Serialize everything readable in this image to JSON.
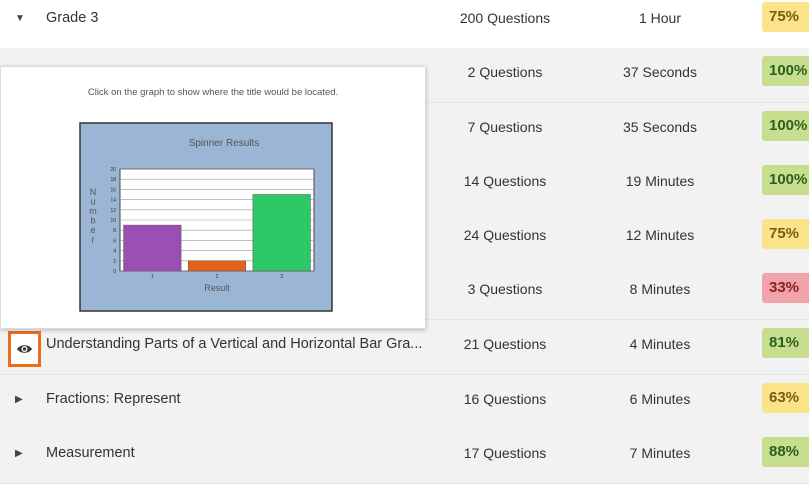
{
  "rows": [
    {
      "title": "Grade 3",
      "questions": "200 Questions",
      "time": "1 Hour",
      "score": "75%",
      "score_color": "yellow",
      "caret": "down"
    },
    {
      "title": "",
      "questions": "2 Questions",
      "time": "37 Seconds",
      "score": "100%",
      "score_color": "green"
    },
    {
      "title": "",
      "questions": "7 Questions",
      "time": "35 Seconds",
      "score": "100%",
      "score_color": "green"
    },
    {
      "title": "",
      "questions": "14 Questions",
      "time": "19 Minutes",
      "score": "100%",
      "score_color": "green"
    },
    {
      "title": "",
      "questions": "24 Questions",
      "time": "12 Minutes",
      "score": "75%",
      "score_color": "yellow"
    },
    {
      "title": "",
      "questions": "3 Questions",
      "time": "8 Minutes",
      "score": "33%",
      "score_color": "red"
    },
    {
      "title": "Understanding Parts of a Vertical and Horizontal Bar Gra...",
      "questions": "21 Questions",
      "time": "4 Minutes",
      "score": "81%",
      "score_color": "green",
      "icon": "eye-icon"
    },
    {
      "title": "Fractions: Represent",
      "questions": "16 Questions",
      "time": "6 Minutes",
      "score": "63%",
      "score_color": "yellow",
      "caret": "right"
    },
    {
      "title": "Measurement",
      "questions": "17 Questions",
      "time": "7 Minutes",
      "score": "88%",
      "score_color": "green",
      "caret": "right"
    }
  ],
  "preview": {
    "prompt": "Click on the graph to show where the title would be located.",
    "chart_data": {
      "type": "bar",
      "title": "Spinner Results",
      "xlabel": "Result",
      "ylabel": "Number",
      "categories": [
        "1",
        "2",
        "3"
      ],
      "values": [
        9,
        2,
        15
      ],
      "colors": [
        "#9b4fb3",
        "#e5621b",
        "#2ec866"
      ],
      "ylim": [
        0,
        20
      ],
      "yticks": [
        "0",
        "2",
        "4",
        "6",
        "8",
        "10",
        "12",
        "14",
        "16",
        "18",
        "20"
      ],
      "grid": true,
      "background": "#9bb5d4"
    }
  }
}
